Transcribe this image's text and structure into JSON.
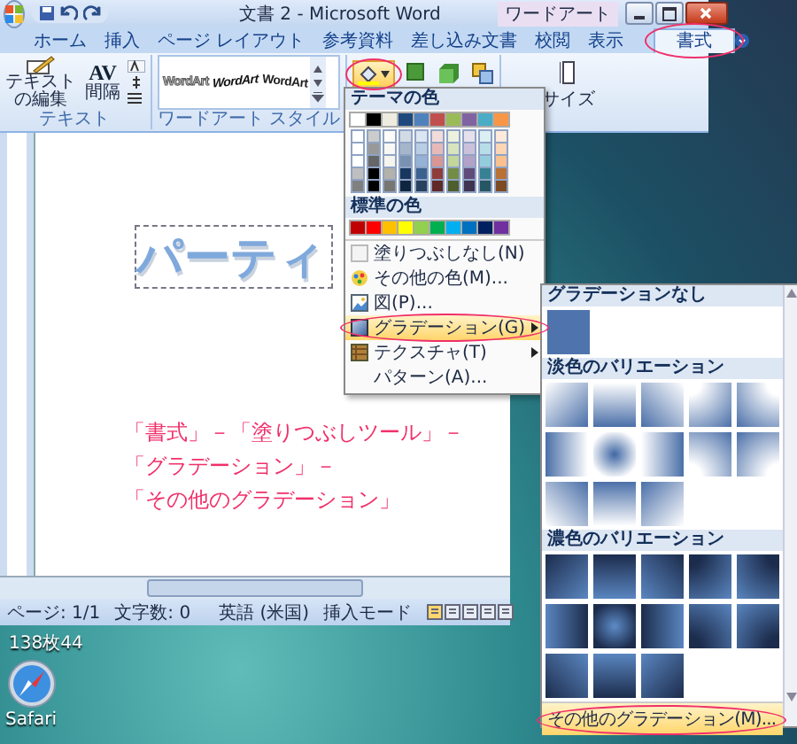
{
  "window": {
    "title": "文書 2 - Microsoft Word",
    "context_label": "ワードアート"
  },
  "tabs": [
    {
      "label": "ホーム",
      "selected": false,
      "circled": false
    },
    {
      "label": "挿入",
      "selected": false,
      "circled": false
    },
    {
      "label": "ページ レイアウト",
      "selected": false,
      "circled": false
    },
    {
      "label": "参考資料",
      "selected": false,
      "circled": false
    },
    {
      "label": "差し込み文書",
      "selected": false,
      "circled": false
    },
    {
      "label": "校閲",
      "selected": false,
      "circled": false
    },
    {
      "label": "表示",
      "selected": false,
      "circled": false
    },
    {
      "label": "書式",
      "selected": true,
      "circled": true
    }
  ],
  "ribbon": {
    "text_group": {
      "label": "テキスト",
      "edit_button": "テキストの編集",
      "spacing_button": "間隔",
      "spacing_icon": "AV"
    },
    "wordart_group": {
      "label": "ワードアート スタイル",
      "samples": [
        "WordArt",
        "WordArt",
        "WordArt"
      ]
    },
    "fill_button": {
      "circled": true
    },
    "size_label": "サイズ"
  },
  "document": {
    "wordart": "パーティ",
    "annotation": [
      "「書式」－「塗りつぶしツール」－",
      "「グラデーション」－",
      "「その他のグラデーション」"
    ]
  },
  "status_bar": [
    "ページ: 1/1",
    "文字数: 0",
    "英語 (米国)",
    "挿入モード"
  ],
  "desktop": {
    "caption": "138枚44",
    "icons": [
      {
        "label": "Safari"
      }
    ]
  },
  "fill_menu": {
    "theme_header": "テーマの色",
    "theme_colors": [
      {
        "color": "#ffffff"
      },
      {
        "color": "#000000"
      },
      {
        "color": "#eeece1"
      },
      {
        "color": "#1f497d"
      },
      {
        "color": "#4f81bd"
      },
      {
        "color": "#c0504d"
      },
      {
        "color": "#9bbb59"
      },
      {
        "color": "#8064a2"
      },
      {
        "color": "#4bacc6"
      },
      {
        "color": "#f79646"
      }
    ],
    "standard_header": "標準の色",
    "standard_colors": [
      {
        "color": "#c00000"
      },
      {
        "color": "#ff0000"
      },
      {
        "color": "#ffc000"
      },
      {
        "color": "#ffff00"
      },
      {
        "color": "#92d050"
      },
      {
        "color": "#00b050"
      },
      {
        "color": "#00b0f0"
      },
      {
        "color": "#0070c0"
      },
      {
        "color": "#002060"
      },
      {
        "color": "#7030a0"
      }
    ],
    "items": [
      {
        "label": "塗りつぶしなし(N)",
        "kind": "none",
        "submenu": false,
        "highlighted": false,
        "circled": false
      },
      {
        "label": "その他の色(M)...",
        "kind": "palette",
        "submenu": false,
        "highlighted": false,
        "circled": false
      },
      {
        "label": "図(P)...",
        "kind": "image",
        "submenu": false,
        "highlighted": false,
        "circled": false
      },
      {
        "label": "グラデーション(G)",
        "kind": "gradient",
        "submenu": true,
        "highlighted": true,
        "circled": true
      },
      {
        "label": "テクスチャ(T)",
        "kind": "texture",
        "submenu": true,
        "highlighted": false,
        "circled": false
      },
      {
        "label": "パターン(A)...",
        "kind": "blank",
        "submenu": false,
        "highlighted": false,
        "circled": false
      }
    ]
  },
  "gradient_gallery": {
    "none_header": "グラデーションなし",
    "sections": [
      {
        "title": "淡色のバリエーション",
        "kind": "light"
      },
      {
        "title": "濃色のバリエーション",
        "kind": "dark"
      }
    ],
    "more": {
      "label": "その他のグラデーション(M)...",
      "highlighted": true,
      "circled": true
    }
  }
}
